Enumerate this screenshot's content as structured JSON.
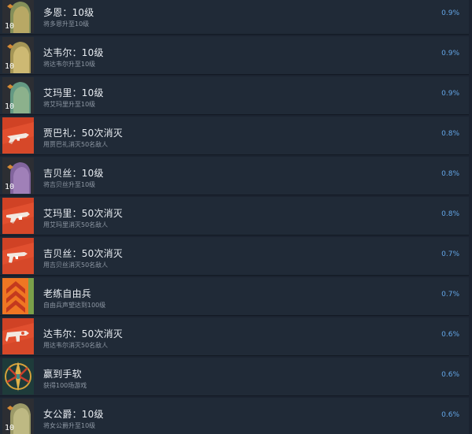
{
  "achievements": [
    {
      "icon": "portrait-level-icon",
      "badge": "10",
      "title": "多恩：10级",
      "description": "将多恩升至10级",
      "percent": "0.9%"
    },
    {
      "icon": "portrait-level-icon",
      "badge": "10",
      "title": "达韦尔：10级",
      "description": "将达韦尔升至10级",
      "percent": "0.9%"
    },
    {
      "icon": "portrait-level-icon",
      "badge": "10",
      "title": "艾玛里：10级",
      "description": "将艾玛里升至10级",
      "percent": "0.9%"
    },
    {
      "icon": "weapon-kill-icon",
      "title": "贾巴礼：50次消灭",
      "description": "用贾巴礼消灭50名敌人",
      "percent": "0.8%"
    },
    {
      "icon": "portrait-level-icon",
      "badge": "10",
      "title": "吉贝丝：10级",
      "description": "将吉贝丝升至10级",
      "percent": "0.8%"
    },
    {
      "icon": "weapon-kill-icon",
      "title": "艾玛里：50次消灭",
      "description": "用艾玛里消灭50名敌人",
      "percent": "0.8%"
    },
    {
      "icon": "weapon-kill-icon",
      "title": "吉贝丝：50次消灭",
      "description": "用吉贝丝消灭50名敌人",
      "percent": "0.7%"
    },
    {
      "icon": "rank-chevrons-icon",
      "title": "老练自由兵",
      "description": "自由兵声望达到100级",
      "percent": "0.7%"
    },
    {
      "icon": "weapon-kill-icon",
      "title": "达韦尔：50次消灭",
      "description": "用达韦尔消灭50名敌人",
      "percent": "0.6%"
    },
    {
      "icon": "trophy-emblem-icon",
      "title": "赢到手软",
      "description": "获得100场游戏",
      "percent": "0.6%"
    },
    {
      "icon": "portrait-level-icon",
      "badge": "10",
      "title": "女公爵：10级",
      "description": "将女公爵升至10级",
      "percent": "0.6%"
    }
  ],
  "colors": {
    "background": "#1b2330",
    "row": "#202a37",
    "title": "#e9edf2",
    "description": "#8d97a3",
    "percent": "#64a7e8",
    "weapon_red": "#e14f2f",
    "rank_orange": "#f07a25"
  }
}
